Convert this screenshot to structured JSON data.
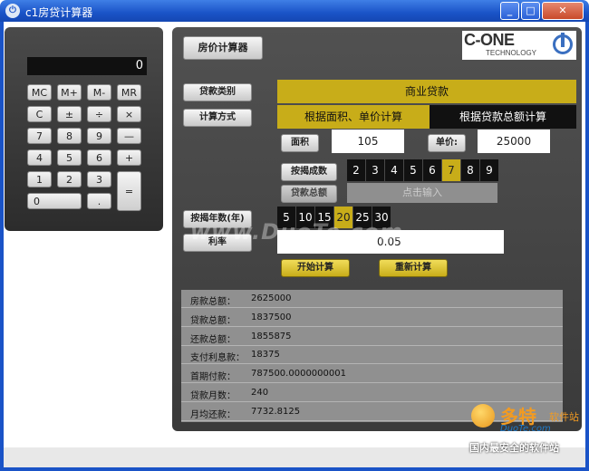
{
  "window": {
    "title": "c1房贷计算器",
    "min_glyph": "_",
    "max_glyph": "□",
    "close_glyph": "✕"
  },
  "calculator": {
    "display": "0",
    "keys": [
      "MC",
      "M+",
      "M-",
      "MR",
      "C",
      "±",
      "÷",
      "×",
      "7",
      "8",
      "9",
      "—",
      "4",
      "5",
      "6",
      "+",
      "1",
      "2",
      "3",
      "=",
      "0",
      "."
    ]
  },
  "main": {
    "title_button": "房价计算器",
    "logo": {
      "main": "C-ONE",
      "sub": "TECHNOLOGY"
    },
    "loan_type_button": "贷款类别",
    "loan_type_value": "商业贷款",
    "calc_method_button": "计算方式",
    "calc_method_left": "根据面积、单价计算",
    "calc_method_right": "根据贷款总额计算",
    "area_label": "面积",
    "area_value": "105",
    "price_label": "单价:",
    "price_value": "25000",
    "ratio_button": "按揭成数",
    "ratio_options": [
      "2",
      "3",
      "4",
      "5",
      "6",
      "7",
      "8",
      "9"
    ],
    "ratio_selected": "7",
    "total_button": "贷款总额",
    "total_placeholder": "点击输入",
    "years_button": "按揭年数(年)",
    "years_options": [
      "5",
      "10",
      "15",
      "20",
      "25",
      "30"
    ],
    "years_selected": "20",
    "rate_button": "利率",
    "rate_value": "0.05",
    "start_button": "开始计算",
    "reset_button": "重新计算",
    "results": [
      {
        "label": "房款总额：",
        "value": "2625000"
      },
      {
        "label": "贷款总额：",
        "value": "1837500"
      },
      {
        "label": "还款总额：",
        "value": "1855875"
      },
      {
        "label": "支付利息款：",
        "value": "18375"
      },
      {
        "label": "首期付款：",
        "value": "78750​0.0000000001"
      },
      {
        "label": "贷款月数：",
        "value": "240"
      },
      {
        "label": "月均还款：",
        "value": "7732.8125"
      }
    ]
  },
  "watermarks": {
    "center": "www.DuoTe.com",
    "corner_brand": "多特",
    "corner_suffix": "软件站",
    "corner_site": "DuoTe.com",
    "corner_slogan": "国内最安全的软件站"
  },
  "colors": {
    "accent_yellow": "#c8ad19",
    "panel_dark": "#3a3a3a",
    "titlebar_blue": "#1a53c7"
  }
}
